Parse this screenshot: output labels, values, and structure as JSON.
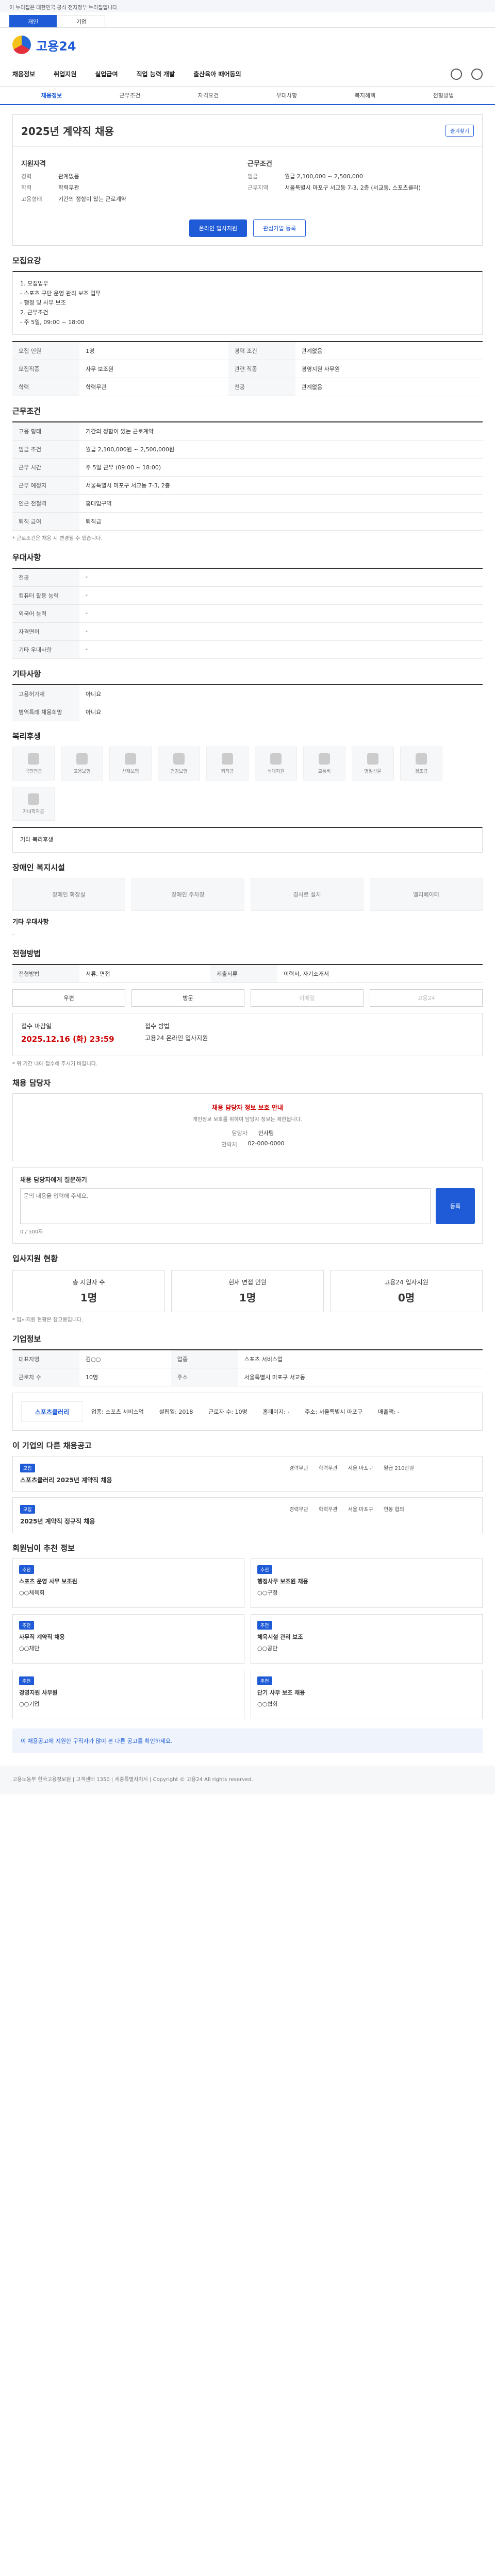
{
  "gov_notice": "이 누리집은 대한민국 공식 전자정부 누리집입니다.",
  "user_tabs": [
    "개인",
    "기업"
  ],
  "logo": "고용24",
  "gnb": [
    "채용정보",
    "취업지원",
    "실업급여",
    "직업 능력 개발",
    "출산육아 때어동의"
  ],
  "sub_tabs": [
    "채용정보",
    "근무조건",
    "자격요건",
    "우대사항",
    "복지혜택",
    "전형방법"
  ],
  "header": {
    "title": "2025년 계약직 채용",
    "badge": "즐겨찾기"
  },
  "summary": {
    "left_title": "지원자격",
    "right_title": "근무조건",
    "left": [
      {
        "k": "경력",
        "v": "관계없음"
      },
      {
        "k": "학력",
        "v": "학력무관"
      },
      {
        "k": "고용형태",
        "v": "기간의 정함이 있는 근로계약"
      }
    ],
    "right": [
      {
        "k": "임금",
        "v": "월급 2,100,000 ~ 2,500,000"
      },
      {
        "k": "근무지역",
        "v": "서울특별시 마포구 서교동 7-3, 2층 (서교동, 스포츠클러)"
      }
    ]
  },
  "buttons": {
    "apply": "온라인 입사지원",
    "interest": "관심기업 등록"
  },
  "sec": {
    "recruit": "모집요강",
    "cond": "근무조건",
    "prefer": "우대사항",
    "extra": "기타사항",
    "welfare": "복리후생",
    "disabled": "장애인 복지시설",
    "other": "기타 우대사항",
    "process": "전형방법",
    "contact": "채용 담당자",
    "inquiry": "1:1 채용문의",
    "status": "입사지원 현황",
    "company": "기업정보",
    "similar": "이 기업의 다른 채용공고",
    "recommend": "회원님이 추천 정보"
  },
  "recruit_text": "1. 모집업무\n - 스포츠 구단 운영 관리 보조 업무\n - 행정 및 사무 보조\n2. 근무조건\n - 주 5일, 09:00 ~ 18:00",
  "recruit_tbl": [
    {
      "k": "모집 인원",
      "v": "1명",
      "k2": "경력 조건",
      "v2": "관계없음"
    },
    {
      "k": "모집직종",
      "v": "사무 보조원",
      "k2": "관련 직종",
      "v2": "경영지원 사무원"
    },
    {
      "k": "학력",
      "v": "학력무관",
      "k2": "전공",
      "v2": "관계없음"
    }
  ],
  "cond_tbl": [
    {
      "k": "고용 형태",
      "v": "기간의 정함이 있는 근로계약"
    },
    {
      "k": "임금 조건",
      "v": "월급 2,100,000원 ~ 2,500,000원"
    },
    {
      "k": "근무 시간",
      "v": "주 5일 근무 (09:00 ~ 18:00)"
    },
    {
      "k": "근무 예정지",
      "v": "서울특별시 마포구 서교동 7-3, 2층"
    },
    {
      "k": "인근 전철역",
      "v": "홍대입구역"
    },
    {
      "k": "퇴직 금여",
      "v": "퇴직금"
    }
  ],
  "cond_note": "* 근로조건은 채용 시 변경될 수 있습니다.",
  "prefer_tbl": [
    {
      "k": "전공",
      "v": "-"
    },
    {
      "k": "컴퓨터 활용 능력",
      "v": "-"
    },
    {
      "k": "외국어 능력",
      "v": "-"
    },
    {
      "k": "자격면허",
      "v": "-"
    },
    {
      "k": "기타 우대사항",
      "v": "-"
    }
  ],
  "extra_tbl": [
    {
      "k": "고용허가제",
      "v": "아니요"
    },
    {
      "k": "병역특례 채용희망",
      "v": "아니요"
    }
  ],
  "welfare_items": [
    "국민연금",
    "고용보험",
    "산재보험",
    "건강보험",
    "퇴직금",
    "식대지원",
    "교통비",
    "명절선물",
    "경조금",
    "자녀학자금"
  ],
  "welfare_note": "기타 복리후생",
  "disabled_items": [
    "장애인 화장실",
    "장애인 주차장",
    "경사로 설치",
    "엘리베이터"
  ],
  "other_note": "-",
  "process_tbl": [
    {
      "k": "전형방법",
      "v": "서류, 면접",
      "k2": "제출서류",
      "v2": "이력서, 자기소개서"
    }
  ],
  "process_methods": [
    "우편",
    "방문",
    "이메일",
    "고용24"
  ],
  "apply": {
    "deadline_label": "접수 마감일",
    "deadline": "2025.12.16 (화) 23:59",
    "method_label": "접수 방법",
    "method": "고용24 온라인 입사지원"
  },
  "process_notes": "* 위 기간 내에 접수해 주시기 바랍니다.",
  "contact": {
    "warn": "채용 담당자 정보 보호 안내",
    "desc": "개인정보 보호를 위하여 담당자 정보는 제한됩니다.",
    "label": "담당자",
    "value": "인사팀",
    "phone_label": "연락처",
    "phone": "02-000-0000"
  },
  "inquiry": {
    "label": "채용 담당자에게 질문하기",
    "placeholder": "문의 내용을 입력해 주세요.",
    "btn": "등록",
    "count": "0 / 500자"
  },
  "status": [
    {
      "k": "총 지원자 수",
      "v": "1명"
    },
    {
      "k": "현재 면접 인원",
      "v": "1명"
    },
    {
      "k": "고용24 입사지원",
      "v": "0명"
    }
  ],
  "status_note": "* 입사지원 현황은 참고용입니다.",
  "company_tbl": [
    {
      "k": "대표자명",
      "v": "김○○"
    },
    {
      "k": "업종",
      "v": "스포츠 서비스업"
    },
    {
      "k": "근로자 수",
      "v": "10명"
    },
    {
      "k": "주소",
      "v": "서울특별시 마포구 서교동"
    }
  ],
  "company": {
    "logo": "스포츠클러리",
    "name": "스포츠클러리(주)",
    "fields": [
      "업종: 스포츠 서비스업",
      "설립일: 2018",
      "근로자 수: 10명",
      "홈페이지: -",
      "주소: 서울특별시 마포구",
      "매출액: -"
    ]
  },
  "jobs": [
    {
      "tag": "모집",
      "title": "스포츠클러리 2025년 계약직 채용",
      "meta": [
        "경력무관",
        "학력무관",
        "서울 마포구",
        "월급 210만원"
      ]
    },
    {
      "tag": "모집",
      "title": "2025년 계약직 정규직 채용",
      "meta": [
        "경력무관",
        "학력무관",
        "서울 마포구",
        "연봉 협의"
      ]
    }
  ],
  "recommend": [
    {
      "tag": "추천",
      "title": "스포츠 운영 사무 보조원",
      "org": "○○체육회"
    },
    {
      "tag": "추천",
      "title": "행정사무 보조원 채용",
      "org": "○○구청"
    },
    {
      "tag": "추천",
      "title": "사무직 계약직 채용",
      "org": "○○재단"
    },
    {
      "tag": "추천",
      "title": "체육시설 관리 보조",
      "org": "○○공단"
    },
    {
      "tag": "추천",
      "title": "경영지원 사무원",
      "org": "○○기업"
    },
    {
      "tag": "추천",
      "title": "단기 사무 보조 채용",
      "org": "○○협회"
    }
  ],
  "banner": "이 채용공고에 지원한 구직자가 많이 본 다른 공고를 확인하세요.",
  "footer": "고용노동부 한국고용정보원 | 고객센터 1350 | 세종특별자치시 | Copyright © 고용24 All rights reserved."
}
